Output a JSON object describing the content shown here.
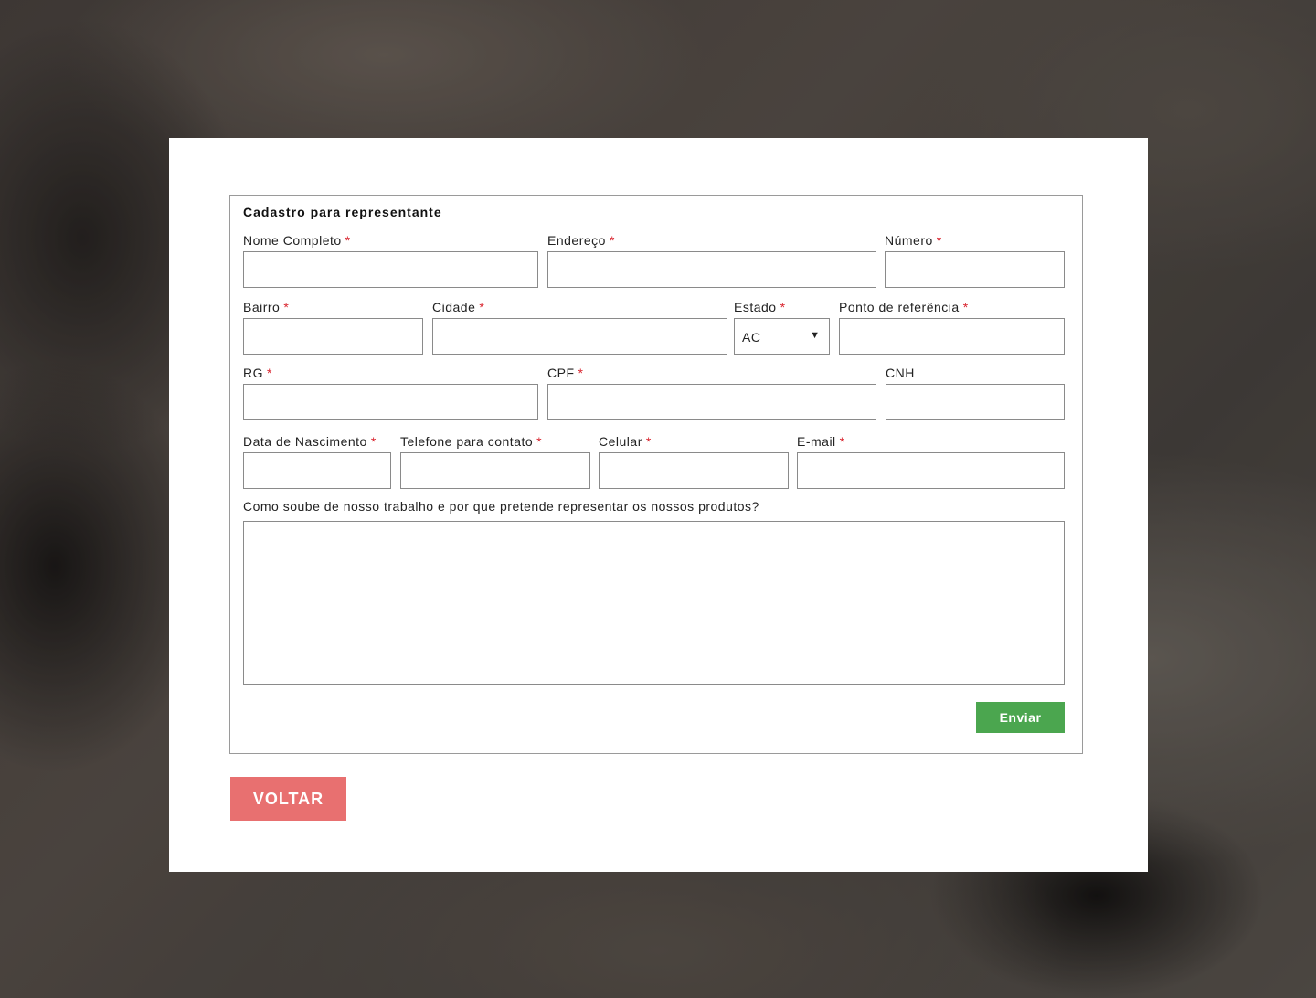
{
  "form": {
    "legend": "Cadastro para representante",
    "required_marker": "*",
    "fields": {
      "nome_completo": "Nome Completo",
      "endereco": "Endereço",
      "numero": "Número",
      "bairro": "Bairro",
      "cidade": "Cidade",
      "estado": "Estado",
      "estado_selected": "AC",
      "ponto_referencia": "Ponto de referência",
      "rg": "RG",
      "cpf": "CPF",
      "cnh": "CNH",
      "data_nascimento": "Data de Nascimento",
      "telefone": "Telefone para contato",
      "celular": "Celular",
      "email": "E-mail",
      "mensagem": "Como soube de nosso trabalho e por que pretende representar os nossos produtos?"
    },
    "submit_label": "Enviar"
  },
  "back_label": "VOLTAR",
  "colors": {
    "submit": "#4ba64f",
    "back": "#e87070",
    "required": "#d9232d"
  }
}
